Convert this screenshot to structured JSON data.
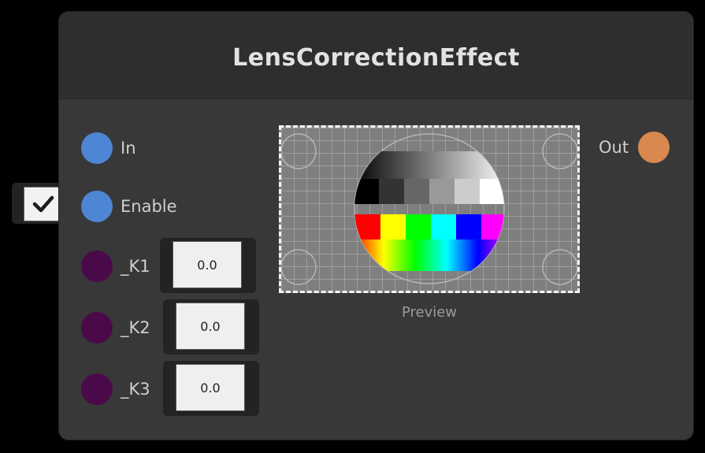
{
  "node": {
    "title": "LensCorrectionEffect",
    "inputs": [
      {
        "label": "In",
        "color": "#4e86d4",
        "type": "texture"
      },
      {
        "label": "Enable",
        "color": "#4e86d4",
        "type": "bool",
        "checked": true
      },
      {
        "label": "_K1",
        "color": "#4a0a4a",
        "type": "float",
        "value": "0.0"
      },
      {
        "label": "_K2",
        "color": "#4a0a4a",
        "type": "float",
        "value": "0.0"
      },
      {
        "label": "_K3",
        "color": "#4a0a4a",
        "type": "float",
        "value": "0.0"
      }
    ],
    "outputs": [
      {
        "label": "Out",
        "color": "#d98850"
      }
    ],
    "preview": {
      "label": "Preview",
      "image_icon": "test-pattern-icon"
    },
    "icons": {
      "checkbox": "check-icon"
    }
  }
}
